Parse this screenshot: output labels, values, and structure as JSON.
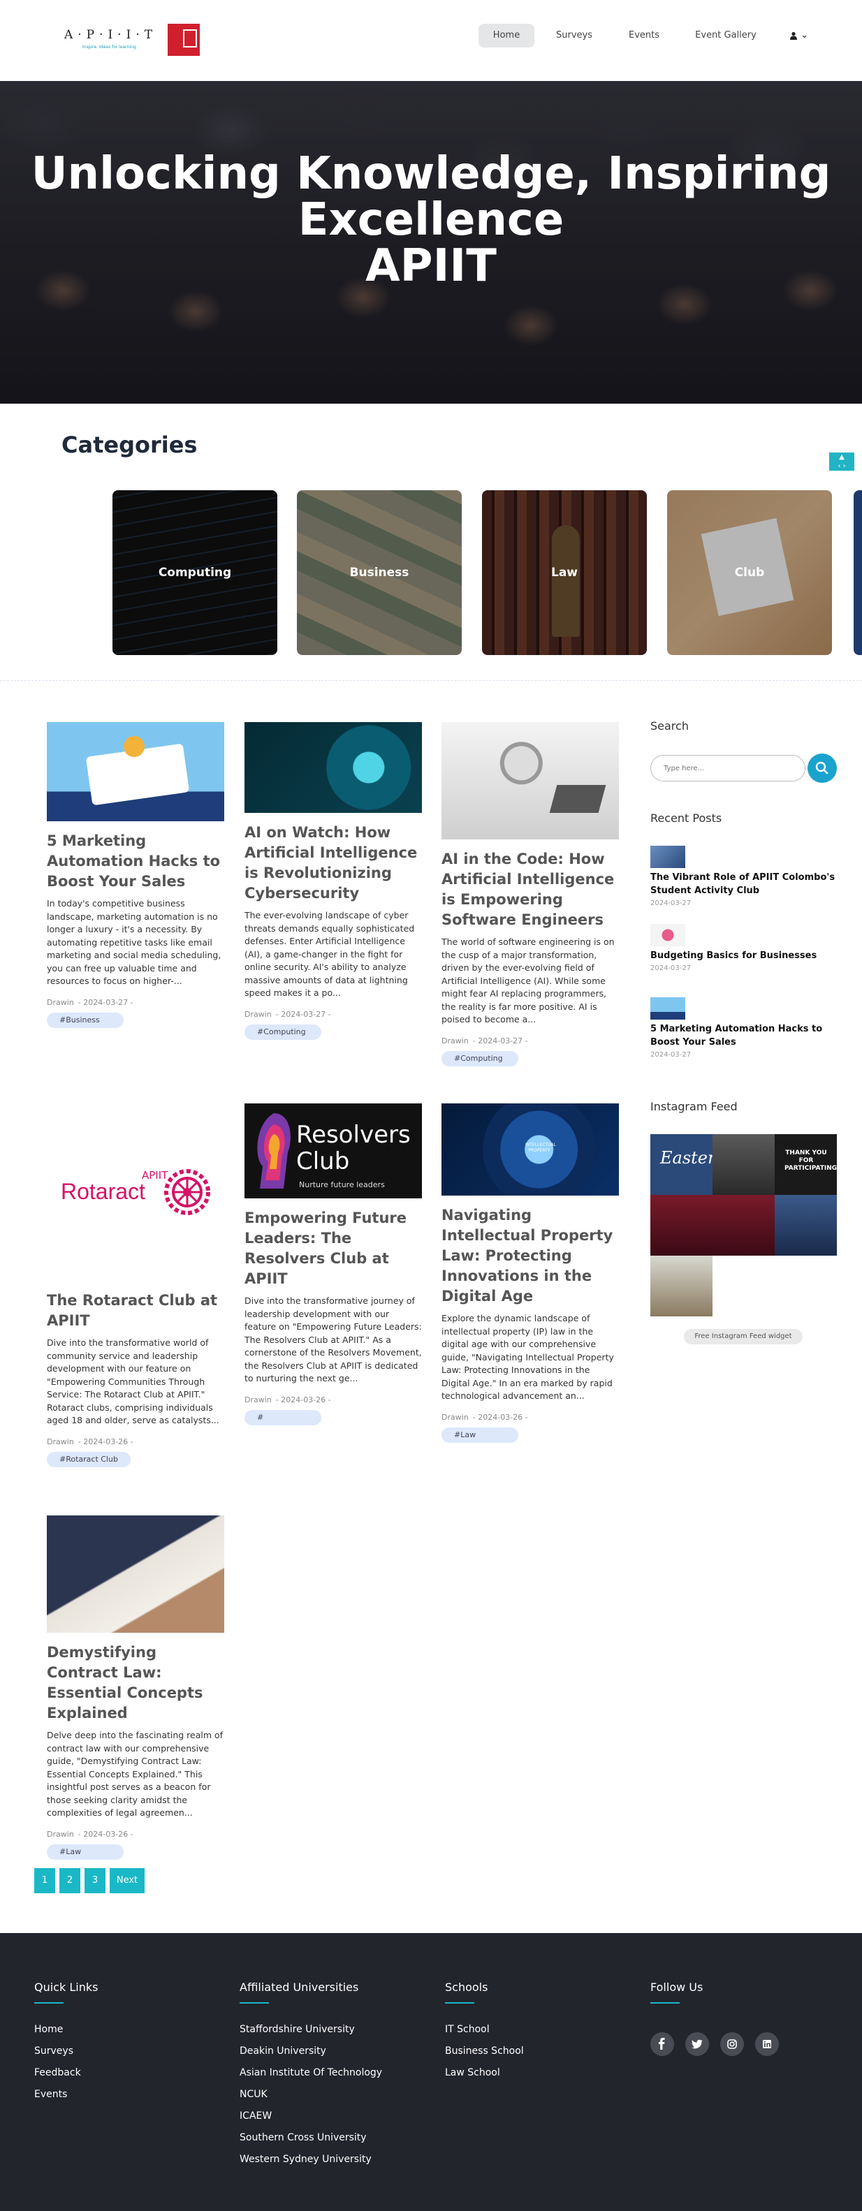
{
  "brand": {
    "apiit_word": "A·P·I·I·T",
    "apiit_tagline": "Inspire. Ideas for learning"
  },
  "nav": {
    "items": [
      "Home",
      "Surveys",
      "Events",
      "Event Gallery"
    ],
    "active": "Home",
    "user_chevron": "⌄"
  },
  "hero": {
    "line1": "Unlocking Knowledge, Inspiring",
    "line2": "Excellence",
    "line3": "APIIT"
  },
  "categories": {
    "heading": "Categories",
    "items": [
      "Computing",
      "Business",
      "Law",
      "Club"
    ]
  },
  "posts": [
    {
      "title": "5 Marketing Automation Hacks to Boost Your Sales",
      "excerpt": "In today's competitive business landscape, marketing automation is no longer a luxury - it's a necessity. By automating repetitive tasks like email marketing and social media scheduling, you can free up valuable time and resources to focus on higher-...",
      "author": "Drawin",
      "date": "- 2024-03-27 -",
      "tag": "#Business"
    },
    {
      "title": "AI on Watch: How Artificial Intelligence is Revolutionizing Cybersecurity",
      "excerpt": "The ever-evolving landscape of cyber threats demands equally sophisticated defenses. Enter Artificial Intelligence (AI), a game-changer in the fight for online security. AI's ability to analyze massive amounts of data at lightning speed makes it a po...",
      "author": "Drawin",
      "date": "- 2024-03-27 -",
      "tag": "#Computing"
    },
    {
      "title": "AI in the Code: How Artificial Intelligence is Empowering Software Engineers",
      "excerpt": "The world of software engineering is on the cusp of a major transformation, driven by the ever-evolving field of Artificial Intelligence (AI). While some might fear AI replacing programmers, the reality is far more positive. AI is poised to become a...",
      "author": "Drawin",
      "date": "- 2024-03-27 -",
      "tag": "#Computing"
    },
    {
      "title": "The Rotaract Club at APIIT",
      "excerpt": "Dive into the transformative world of community service and leadership development with our feature on \"Empowering Communities Through Service: The Rotaract Club at APIIT.\" Rotaract clubs, comprising individuals aged 18 and older, serve as catalysts...",
      "author": "Drawin",
      "date": "- 2024-03-26 -",
      "tag": "#Rotaract Club"
    },
    {
      "title": "Empowering Future Leaders: The Resolvers Club at APIIT",
      "excerpt": "Dive into the transformative journey of leadership development with our feature on \"Empowering Future Leaders: The Resolvers Club at APIIT.\" As a cornerstone of the Resolvers Movement, the Resolvers Club at APIIT is dedicated to nurturing the next ge...",
      "author": "Drawin",
      "date": "- 2024-03-26 -",
      "tag": "#"
    },
    {
      "title": "Navigating Intellectual Property Law: Protecting Innovations in the Digital Age",
      "excerpt": "Explore the dynamic landscape of intellectual property (IP) law in the digital age with our comprehensive guide, \"Navigating Intellectual Property Law: Protecting Innovations in the Digital Age.\" In an era marked by rapid technological advancement an...",
      "author": "Drawin",
      "date": "- 2024-03-26 -",
      "tag": "#Law"
    },
    {
      "title": "Demystifying Contract Law: Essential Concepts Explained",
      "excerpt": "Delve deep into the fascinating realm of contract law with our comprehensive guide, \"Demystifying Contract Law: Essential Concepts Explained.\" This insightful post serves as a beacon for those seeking clarity amidst the complexities of legal agreemen...",
      "author": "Drawin",
      "date": "- 2024-03-26 -",
      "tag": "#Law"
    }
  ],
  "images_text": {
    "rotaract_apiit": "APIIT",
    "rotaract_name": "Rotaract",
    "resolvers_name": "Resolvers",
    "resolvers_club": "Club",
    "resolvers_tag": "Nurture future leaders",
    "ip_text": "INTELLECTUAL PROPERTY"
  },
  "sidebar": {
    "search_heading": "Search",
    "search_placeholder": "Type here...",
    "recent_heading": "Recent Posts",
    "recent": [
      {
        "title": "The Vibrant Role of APIIT Colombo's Student Activity Club",
        "date": "2024-03-27"
      },
      {
        "title": "Budgeting Basics for Businesses",
        "date": "2024-03-27"
      },
      {
        "title": "5 Marketing Automation Hacks to Boost Your Sales",
        "date": "2024-03-27"
      }
    ],
    "instagram_heading": "Instagram Feed",
    "instagram_widget": "Free Instagram Feed widget",
    "insta_easter": "Easter",
    "insta_thanks": "THANK YOU FOR PARTICIPATING"
  },
  "pagination": {
    "pages": [
      "1",
      "2",
      "3"
    ],
    "next": "Next"
  },
  "footer": {
    "quick_links": {
      "heading": "Quick Links",
      "items": [
        "Home",
        "Surveys",
        "Feedback",
        "Events"
      ]
    },
    "affiliated": {
      "heading": "Affiliated Universities",
      "items": [
        "Staffordshire University",
        "Deakin University",
        "Asian Institute Of Technology",
        "NCUK",
        "ICAEW",
        "Southern Cross University",
        "Western Sydney University"
      ]
    },
    "schools": {
      "heading": "Schools",
      "items": [
        "IT School",
        "Business School",
        "Law School"
      ]
    },
    "follow": {
      "heading": "Follow Us",
      "icons": [
        "facebook-icon",
        "twitter-icon",
        "instagram-icon",
        "linkedin-icon"
      ]
    }
  },
  "colors": {
    "accent": "#1ab8c6",
    "footer_bg": "#23252d",
    "tag_bg": "#dde8fb",
    "search_button": "#1aa3cd"
  }
}
